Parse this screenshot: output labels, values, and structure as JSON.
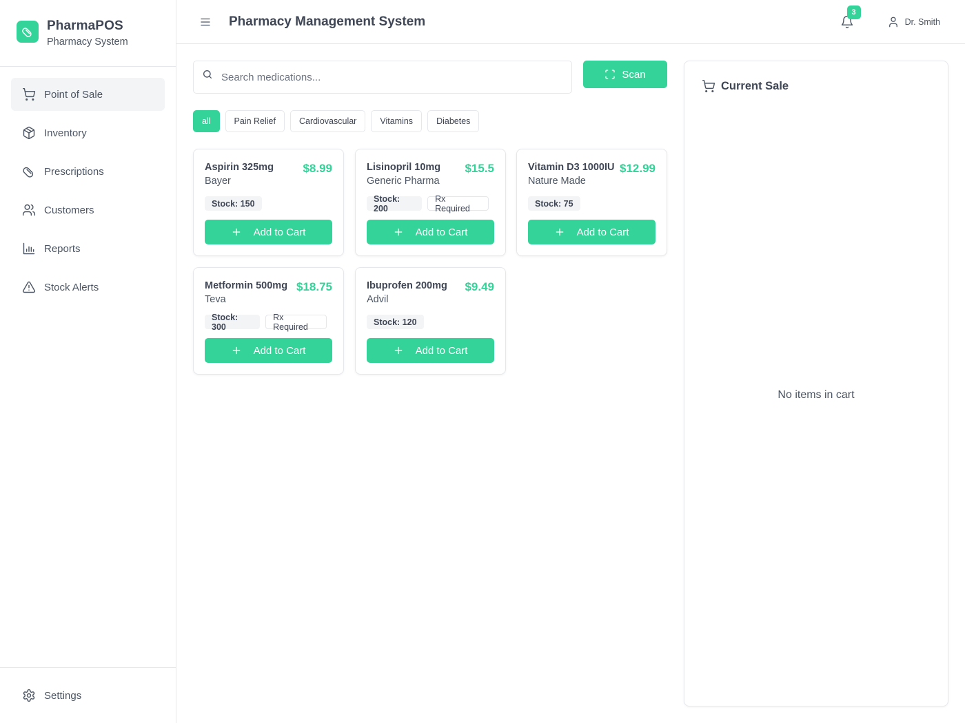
{
  "brand": {
    "name": "PharmaPOS",
    "subtitle": "Pharmacy System",
    "logo_icon": "pill-icon"
  },
  "sidebar": {
    "items": [
      {
        "label": "Point of Sale",
        "icon": "cart-icon",
        "active": true
      },
      {
        "label": "Inventory",
        "icon": "box-icon",
        "active": false
      },
      {
        "label": "Prescriptions",
        "icon": "pill-icon",
        "active": false
      },
      {
        "label": "Customers",
        "icon": "users-icon",
        "active": false
      },
      {
        "label": "Reports",
        "icon": "bar-chart-icon",
        "active": false
      },
      {
        "label": "Stock Alerts",
        "icon": "alert-triangle-icon",
        "active": false
      }
    ],
    "settings_label": "Settings"
  },
  "header": {
    "title": "Pharmacy Management System",
    "notification_count": "3",
    "user_name": "Dr. Smith"
  },
  "search": {
    "placeholder": "Search medications...",
    "value": ""
  },
  "scan_label": "Scan",
  "filters": [
    {
      "label": "all",
      "active": true
    },
    {
      "label": "Pain Relief",
      "active": false
    },
    {
      "label": "Cardiovascular",
      "active": false
    },
    {
      "label": "Vitamins",
      "active": false
    },
    {
      "label": "Diabetes",
      "active": false
    }
  ],
  "products": [
    {
      "name": "Aspirin 325mg",
      "manufacturer": "Bayer",
      "price": "$8.99",
      "stock": "Stock: 150",
      "rx": ""
    },
    {
      "name": "Lisinopril 10mg",
      "manufacturer": "Generic Pharma",
      "price": "$15.5",
      "stock": "Stock: 200",
      "rx": "Rx Required"
    },
    {
      "name": "Vitamin D3 1000IU",
      "manufacturer": "Nature Made",
      "price": "$12.99",
      "stock": "Stock: 75",
      "rx": ""
    },
    {
      "name": "Metformin 500mg",
      "manufacturer": "Teva",
      "price": "$18.75",
      "stock": "Stock: 300",
      "rx": "Rx Required"
    },
    {
      "name": "Ibuprofen 200mg",
      "manufacturer": "Advil",
      "price": "$9.49",
      "stock": "Stock: 120",
      "rx": ""
    }
  ],
  "add_to_cart_label": "Add to Cart",
  "cart": {
    "title": "Current Sale",
    "empty_text": "No items in cart"
  },
  "colors": {
    "accent": "#34d399",
    "border": "#e5e7eb",
    "text": "#3f4655"
  }
}
